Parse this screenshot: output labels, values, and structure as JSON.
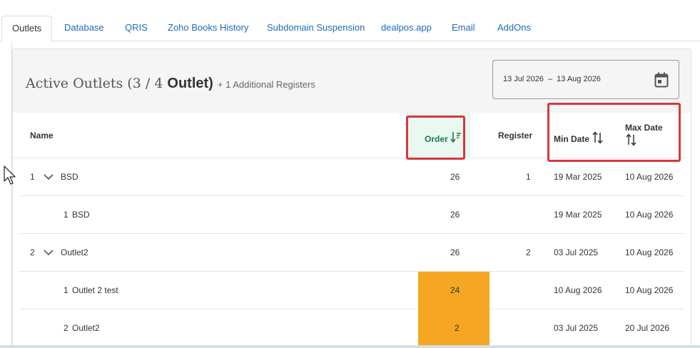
{
  "tabs": [
    {
      "label": "Outlets"
    },
    {
      "label": "Database"
    },
    {
      "label": "QRIS"
    },
    {
      "label": "Zoho Books History"
    },
    {
      "label": "Subdomain Suspension"
    },
    {
      "label": "dealpos.app"
    },
    {
      "label": "Email"
    },
    {
      "label": "AddOns"
    }
  ],
  "header": {
    "title_prefix": "Active Outlets (3 / 4",
    "title_bold": "Outlet)",
    "title_extra": "+ 1 Additional Registers"
  },
  "date_range": {
    "start": "13 Jul 2026",
    "separator": "–",
    "end": "13 Aug 2026"
  },
  "columns": {
    "name": "Name",
    "order": "Order",
    "register": "Register",
    "min_date": "Min Date",
    "max_date": "Max Date"
  },
  "rows": [
    {
      "num": "1",
      "name": "BSD",
      "order": "26",
      "register": "1",
      "min_date": "19 Mar 2025",
      "max_date": "10 Aug 2026",
      "expandable": true
    },
    {
      "num": "1",
      "name": "BSD",
      "order": "26",
      "register": "",
      "min_date": "19 Mar 2025",
      "max_date": "10 Aug 2026",
      "expandable": false
    },
    {
      "num": "2",
      "name": "Outlet2",
      "order": "26",
      "register": "2",
      "min_date": "03 Jul 2025",
      "max_date": "10 Aug 2026",
      "expandable": true
    },
    {
      "num": "1",
      "name": "Outlet 2 test",
      "order": "24",
      "register": "",
      "min_date": "10 Aug 2026",
      "max_date": "10 Aug 2026",
      "expandable": false
    },
    {
      "num": "2",
      "name": "Outlet2",
      "order": "2",
      "register": "",
      "min_date": "03 Jul 2025",
      "max_date": "20 Jul 2026",
      "expandable": false
    }
  ],
  "colors": {
    "accent_green": "#1e7a4a",
    "highlight_orange": "#f5a623",
    "annotation_red": "#d9363e",
    "link_blue": "#1e6bb8"
  }
}
